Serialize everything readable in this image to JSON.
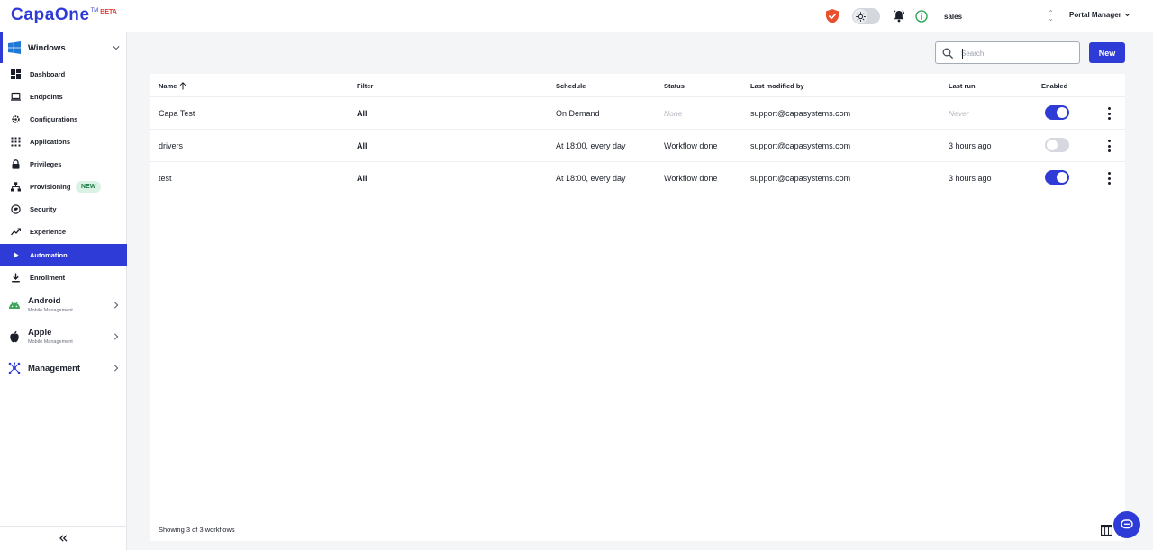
{
  "header": {
    "logo": "CapaOne",
    "logo_tm": "TM",
    "logo_beta": "BETA",
    "tenant": "sales",
    "user": "Portal Manager"
  },
  "sidebar": {
    "windows": {
      "label": "Windows"
    },
    "items": [
      {
        "label": "Dashboard",
        "icon": "dashboard-icon"
      },
      {
        "label": "Endpoints",
        "icon": "laptop-icon"
      },
      {
        "label": "Configurations",
        "icon": "gear-icon"
      },
      {
        "label": "Applications",
        "icon": "grid-icon"
      },
      {
        "label": "Privileges",
        "icon": "lock-icon"
      },
      {
        "label": "Provisioning",
        "icon": "network-icon",
        "badge": "NEW"
      },
      {
        "label": "Security",
        "icon": "security-icon"
      },
      {
        "label": "Experience",
        "icon": "trend-icon"
      },
      {
        "label": "Automation",
        "icon": "play-icon",
        "active": true
      },
      {
        "label": "Enrollment",
        "icon": "download-icon"
      }
    ],
    "android": {
      "label": "Android",
      "sub": "Mobile Management"
    },
    "apple": {
      "label": "Apple",
      "sub": "Mobile Management"
    },
    "management": {
      "label": "Management"
    }
  },
  "toolbar": {
    "search_placeholder": "Search",
    "new_label": "New"
  },
  "table": {
    "columns": {
      "name": "Name",
      "filter": "Filter",
      "schedule": "Schedule",
      "status": "Status",
      "modified": "Last modified by",
      "lastrun": "Last run",
      "enabled": "Enabled"
    },
    "rows": [
      {
        "name": "Capa Test",
        "filter": "All",
        "schedule": "On Demand",
        "status": "None",
        "modified": "support@capasystems.com",
        "lastrun": "Never",
        "enabled": true
      },
      {
        "name": "drivers",
        "filter": "All",
        "schedule": "At 18:00, every day",
        "status": "Workflow done",
        "modified": "support@capasystems.com",
        "lastrun": "3 hours ago",
        "enabled": false
      },
      {
        "name": "test",
        "filter": "All",
        "schedule": "At 18:00, every day",
        "status": "Workflow done",
        "modified": "support@capasystems.com",
        "lastrun": "3 hours ago",
        "enabled": true
      }
    ],
    "footer": "Showing 3 of 3 workflows"
  },
  "colors": {
    "accent": "#2f3bd6",
    "new_badge_bg": "#d9f2e3",
    "new_badge_text": "#1c7a46",
    "shield": "#e8502e",
    "info": "#20a04a"
  }
}
